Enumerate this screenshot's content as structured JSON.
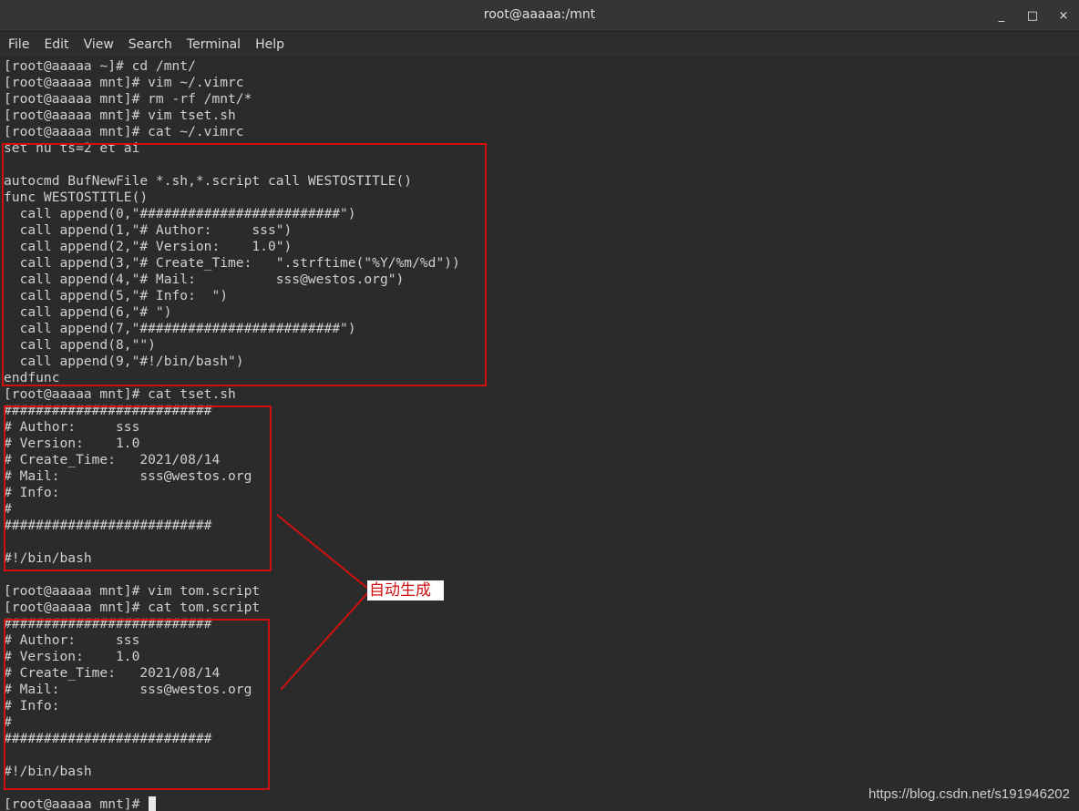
{
  "window": {
    "title": "root@aaaaa:/mnt",
    "minimize_icon": "minimize-icon",
    "maximize_icon": "maximize-icon",
    "close_icon": "close-icon",
    "minimize_glyph": "_",
    "maximize_glyph": "□",
    "close_glyph": "×"
  },
  "menu": {
    "items": [
      {
        "label": "File"
      },
      {
        "label": "Edit"
      },
      {
        "label": "View"
      },
      {
        "label": "Search"
      },
      {
        "label": "Terminal"
      },
      {
        "label": "Help"
      }
    ]
  },
  "terminal": {
    "lines": [
      "[root@aaaaa ~]# cd /mnt/",
      "[root@aaaaa mnt]# vim ~/.vimrc",
      "[root@aaaaa mnt]# rm -rf /mnt/*",
      "[root@aaaaa mnt]# vim tset.sh",
      "[root@aaaaa mnt]# cat ~/.vimrc",
      "set nu ts=2 et ai",
      "",
      "autocmd BufNewFile *.sh,*.script call WESTOSTITLE()",
      "func WESTOSTITLE()",
      "  call append(0,\"#########################\")",
      "  call append(1,\"# Author:     sss\")",
      "  call append(2,\"# Version:    1.0\")",
      "  call append(3,\"# Create_Time:   \".strftime(\"%Y/%m/%d\"))",
      "  call append(4,\"# Mail:          sss@westos.org\")",
      "  call append(5,\"# Info:  \")",
      "  call append(6,\"# \")",
      "  call append(7,\"#########################\")",
      "  call append(8,\"\")",
      "  call append(9,\"#!/bin/bash\")",
      "endfunc",
      "[root@aaaaa mnt]# cat tset.sh",
      "##########################",
      "# Author:     sss",
      "# Version:    1.0",
      "# Create_Time:   2021/08/14",
      "# Mail:          sss@westos.org",
      "# Info:",
      "#",
      "##########################",
      "",
      "#!/bin/bash",
      "",
      "[root@aaaaa mnt]# vim tom.script",
      "[root@aaaaa mnt]# cat tom.script",
      "##########################",
      "# Author:     sss",
      "# Version:    1.0",
      "# Create_Time:   2021/08/14",
      "# Mail:          sss@westos.org",
      "# Info:",
      "#",
      "##########################",
      "",
      "#!/bin/bash",
      "",
      "[root@aaaaa mnt]# "
    ]
  },
  "annotation": {
    "label": "自动生成",
    "color": "#d01010"
  },
  "watermark": "https://blog.csdn.net/s191946202"
}
